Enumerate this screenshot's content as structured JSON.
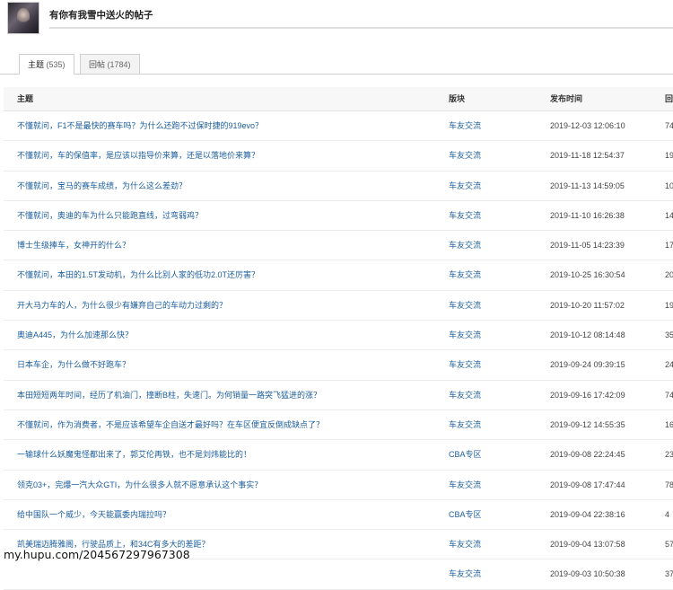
{
  "header": {
    "title": "有你有我雪中送火的帖子"
  },
  "tabs": [
    {
      "label": "主题",
      "count": "(535)"
    },
    {
      "label": "回帖",
      "count": "(1784)"
    }
  ],
  "columns": {
    "topic": "主题",
    "board": "版块",
    "time": "发布时间",
    "replies": "回"
  },
  "rows": [
    {
      "topic": "不懂就问，F1不是最快的赛车吗？为什么还跑不过保时捷的919evo？",
      "board": "车友交流",
      "time": "2019-12-03 12:06:10",
      "replies": "74"
    },
    {
      "topic": "不懂就问，车的保值率，是应该以指导价来算，还是以落地价来算？",
      "board": "车友交流",
      "time": "2019-11-18 12:54:37",
      "replies": "19"
    },
    {
      "topic": "不懂就问，宝马的赛车成绩，为什么这么差劲？",
      "board": "车友交流",
      "time": "2019-11-13 14:59:05",
      "replies": "10"
    },
    {
      "topic": "不懂就问，奥迪的车为什么只能跑直线，过弯弱鸡？",
      "board": "车友交流",
      "time": "2019-11-10 16:26:38",
      "replies": "14"
    },
    {
      "topic": "博士生级捧车，女神开的什么？",
      "board": "车友交流",
      "time": "2019-11-05 14:23:39",
      "replies": "17"
    },
    {
      "topic": "不懂就问，本田的1.5T发动机，为什么比别人家的低功2.0T还厉害？",
      "board": "车友交流",
      "time": "2019-10-25 16:30:54",
      "replies": "20"
    },
    {
      "topic": "开大马力车的人，为什么很少有嫌弃自己的车动力过剩的？",
      "board": "车友交流",
      "time": "2019-10-20 11:57:02",
      "replies": "19"
    },
    {
      "topic": "奥迪A445，为什么加速那么快？",
      "board": "车友交流",
      "time": "2019-10-12 08:14:48",
      "replies": "35"
    },
    {
      "topic": "日本车企，为什么做不好跑车？",
      "board": "车友交流",
      "time": "2019-09-24 09:39:15",
      "replies": "24"
    },
    {
      "topic": "本田短短两年时间，经历了机油门，撞断B柱，失速门。为何销量一路突飞猛进的涨？",
      "board": "车友交流",
      "time": "2019-09-16 17:42:09",
      "replies": "74"
    },
    {
      "topic": "不懂就问，作为消费者，不是应该希望车企自送才最好吗？在车区便宜反倒成缺点了？",
      "board": "车友交流",
      "time": "2019-09-12 14:55:35",
      "replies": "16"
    },
    {
      "topic": "一输球什么妖魔鬼怪都出来了，郭艾伦再铁，也不是刘炜能比的！",
      "board": "CBA专区",
      "time": "2019-09-08 22:24:45",
      "replies": "23"
    },
    {
      "topic": "领克03+，完爆一汽大众GTI，为什么很多人就不愿意承认这个事实？",
      "board": "车友交流",
      "time": "2019-09-08 17:47:44",
      "replies": "78"
    },
    {
      "topic": "给中国队一个威少，今天能赢委内瑞拉吗？",
      "board": "CBA专区",
      "time": "2019-09-04 22:38:16",
      "replies": "4"
    },
    {
      "topic": "凯美瑞迈腾雅阁，行驶品质上，和34C有多大的差距？",
      "board": "车友交流",
      "time": "2019-09-04 13:07:58",
      "replies": "57"
    },
    {
      "topic": "",
      "board": "车友交流",
      "time": "2019-09-03 10:50:38",
      "replies": "37"
    }
  ],
  "watermark": "my.hupu.com/204567297967308"
}
